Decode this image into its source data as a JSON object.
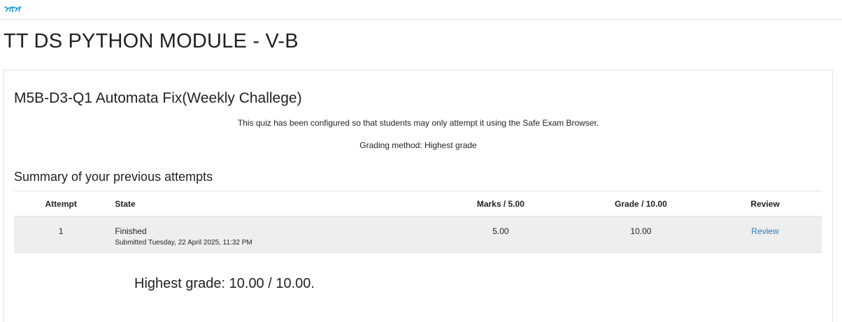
{
  "header": {
    "logo_icon": "wing-logo-icon",
    "logo_color": "#1a9ad6"
  },
  "page": {
    "course_title": "TT DS PYTHON MODULE - V-B"
  },
  "quiz": {
    "title": "M5B-D3-Q1 Automata Fix(Weekly Challege)",
    "seb_notice": "This quiz has been configured so that students may only attempt it using the Safe Exam Browser.",
    "grading_method": "Grading method: Highest grade"
  },
  "summary": {
    "heading": "Summary of your previous attempts",
    "columns": [
      "Attempt",
      "State",
      "Marks / 5.00",
      "Grade / 10.00",
      "Review"
    ],
    "rows": [
      {
        "attempt": "1",
        "state": "Finished",
        "submitted": "Submitted Tuesday, 22 April 2025, 11:32 PM",
        "marks": "5.00",
        "grade": "10.00",
        "review": "Review"
      }
    ],
    "highest_grade": "Highest grade: 10.00 / 10.00."
  },
  "colors": {
    "link": "#2b7bb9",
    "row_background": "#eeeeee"
  }
}
